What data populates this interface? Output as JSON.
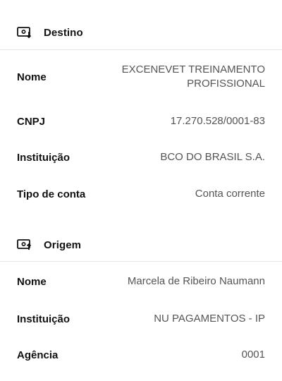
{
  "destino": {
    "title": "Destino",
    "icon": "transfer-in-icon",
    "rows": [
      {
        "label": "Nome",
        "value_line1": "EXCENEVET TREINAMENTO",
        "value_line2": "PROFISSIONAL"
      },
      {
        "label": "CNPJ",
        "value": "17.270.528/0001-83"
      },
      {
        "label": "Instituição",
        "value": "BCO DO BRASIL S.A."
      },
      {
        "label": "Tipo de conta",
        "value": "Conta corrente"
      }
    ]
  },
  "origem": {
    "title": "Origem",
    "icon": "transfer-out-icon",
    "rows": [
      {
        "label": "Nome",
        "value": "Marcela de Ribeiro Naumann"
      },
      {
        "label": "Instituição",
        "value": "NU PAGAMENTOS - IP"
      },
      {
        "label": "Agência",
        "value": "0001"
      }
    ]
  }
}
